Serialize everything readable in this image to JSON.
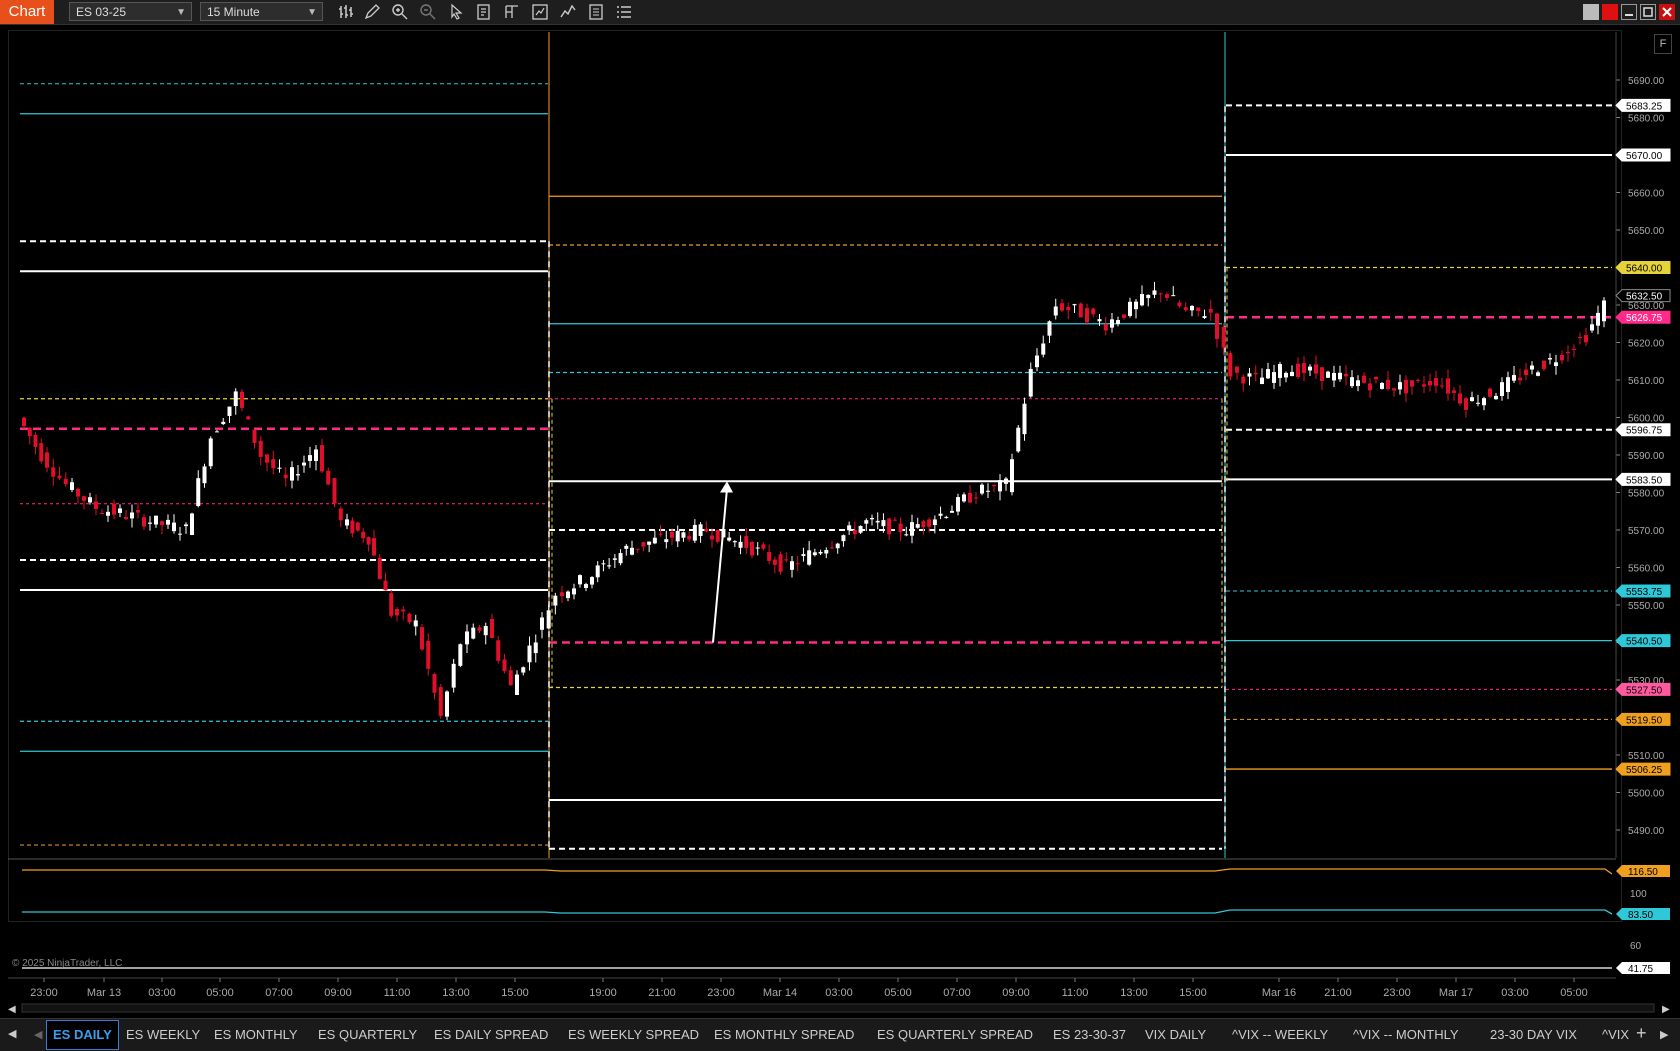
{
  "toolbar": {
    "chart_label": "Chart",
    "instrument": "ES 03-25",
    "interval": "15 Minute",
    "icons": [
      "bar-type-icon",
      "pencil-icon",
      "zoom-in-icon",
      "zoom-out-icon",
      "pointer-icon",
      "properties-icon",
      "template-icon",
      "data-box-icon",
      "indicator-icon",
      "strategy-icon",
      "list-icon"
    ]
  },
  "chart": {
    "copyright": "© 2025 NinjaTrader, LLC",
    "colors": {
      "bull": "#ffffff",
      "bear": "#e0102a",
      "cyan": "#2ec8d8",
      "orange": "#f0a020",
      "yellow": "#e6d23a",
      "pink": "#ff2a8a",
      "white": "#ffffff"
    },
    "price_axis_ticks": [
      "5690.00",
      "5680.00",
      "5670.00",
      "5660.00",
      "5650.00",
      "5640.00",
      "5630.00",
      "5620.00",
      "5610.00",
      "5600.00",
      "5590.00",
      "5580.00",
      "5570.00",
      "5560.00",
      "5550.00",
      "5540.00",
      "5530.00",
      "5520.00",
      "5510.00",
      "5500.00",
      "5490.00"
    ],
    "price_tags": [
      {
        "value": "5683.25",
        "bg": "#ffffff",
        "fg": "#000000"
      },
      {
        "value": "5670.00",
        "bg": "#ffffff",
        "fg": "#000000"
      },
      {
        "value": "5640.00",
        "bg": "#e6d23a",
        "fg": "#000000"
      },
      {
        "value": "5632.50",
        "bg": "#000000",
        "fg": "#ffffff"
      },
      {
        "value": "5626.75",
        "bg": "#ff2a8a",
        "fg": "#ffffff"
      },
      {
        "value": "5596.75",
        "bg": "#ffffff",
        "fg": "#000000"
      },
      {
        "value": "5583.50",
        "bg": "#ffffff",
        "fg": "#000000"
      },
      {
        "value": "5553.75",
        "bg": "#2ec8d8",
        "fg": "#000000"
      },
      {
        "value": "5540.50",
        "bg": "#2ec8d8",
        "fg": "#000000"
      },
      {
        "value": "5527.50",
        "bg": "#ff5aa0",
        "fg": "#000000"
      },
      {
        "value": "5519.50",
        "bg": "#f0a020",
        "fg": "#000000"
      },
      {
        "value": "5506.25",
        "bg": "#f0a020",
        "fg": "#000000"
      }
    ],
    "time_labels": [
      "23:00",
      "Mar 13",
      "03:00",
      "05:00",
      "07:00",
      "09:00",
      "11:00",
      "13:00",
      "15:00",
      "19:00",
      "21:00",
      "23:00",
      "Mar 14",
      "03:00",
      "05:00",
      "07:00",
      "09:00",
      "11:00",
      "13:00",
      "15:00",
      "Mar 16",
      "21:00",
      "23:00",
      "Mar 17",
      "03:00",
      "05:00"
    ],
    "lower_panel": {
      "ticks": [
        "100",
        "80",
        "60"
      ],
      "tags": [
        {
          "value": "116.50",
          "bg": "#f0a020",
          "fg": "#000000"
        },
        {
          "value": "83.50",
          "bg": "#2ec8d8",
          "fg": "#000000"
        },
        {
          "value": "41.75",
          "bg": "#ffffff",
          "fg": "#000000"
        }
      ]
    }
  },
  "tabs": [
    "ES DAILY",
    "ES WEEKLY",
    "ES MONTHLY",
    "ES QUARTERLY",
    "ES DAILY SPREAD",
    "ES WEEKLY SPREAD",
    "ES MONTHLY SPREAD",
    "ES QUARTERLY SPREAD",
    "ES 23-30-37",
    "VIX DAILY",
    "^VIX -- WEEKLY",
    "^VIX -- MONTHLY",
    "23-30 DAY VIX",
    "^VIX"
  ],
  "tab_active": "ES DAILY",
  "tab_add": "+"
}
